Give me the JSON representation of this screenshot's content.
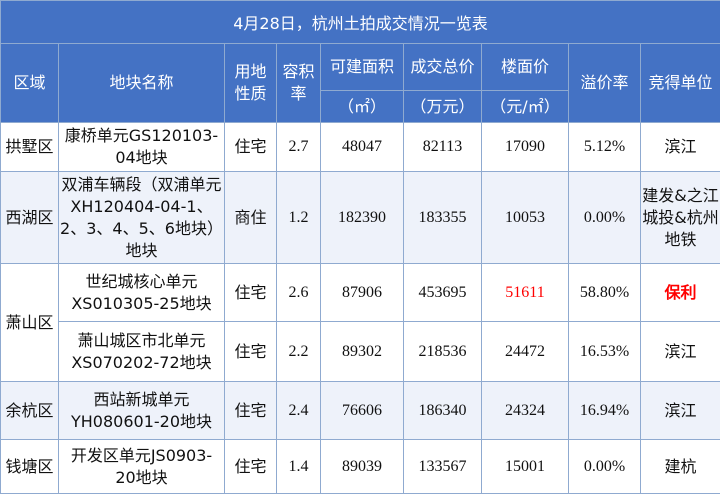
{
  "title": "4月28日，杭州土拍成交情况一览表",
  "headers": {
    "district": "区域",
    "plot_name": "地块名称",
    "land_use": "用地\n性质",
    "plot_ratio": "容积\n率",
    "buildable_area": "可建面积",
    "total_price": "成交总价",
    "floor_price": "楼面价",
    "premium_rate": "溢价率",
    "winner": "竞得单位",
    "buildable_unit": "（㎡）",
    "total_unit": "（万元）",
    "floor_unit": "（元/㎡）"
  },
  "rows": [
    {
      "district": "拱墅区",
      "plot_name": "康桥单元GS120103-04地块",
      "land_use": "住宅",
      "plot_ratio": "2.7",
      "buildable_area": "48047",
      "total_price": "82113",
      "floor_price": "17090",
      "premium_rate": "5.12%",
      "winner": "滨江"
    },
    {
      "district": "西湖区",
      "plot_name": "双浦车辆段（双浦单元XH120404-04-1、2、3、4、5、6地块）地块",
      "land_use": "商住",
      "plot_ratio": "1.2",
      "buildable_area": "182390",
      "total_price": "183355",
      "floor_price": "10053",
      "premium_rate": "0.00%",
      "winner": "建发&之江城投&杭州地铁"
    },
    {
      "district": "萧山区",
      "plot_name": "世纪城核心单元XS010305-25地块",
      "land_use": "住宅",
      "plot_ratio": "2.6",
      "buildable_area": "87906",
      "total_price": "453695",
      "floor_price": "51611",
      "premium_rate": "58.80%",
      "winner": "保利"
    },
    {
      "district": "萧山区",
      "plot_name": "萧山城区市北单元XS070202-72地块",
      "land_use": "住宅",
      "plot_ratio": "2.2",
      "buildable_area": "89302",
      "total_price": "218536",
      "floor_price": "24472",
      "premium_rate": "16.53%",
      "winner": "滨江"
    },
    {
      "district": "余杭区",
      "plot_name": "西站新城单元YH080601-20地块",
      "land_use": "住宅",
      "plot_ratio": "2.4",
      "buildable_area": "76606",
      "total_price": "186340",
      "floor_price": "24324",
      "premium_rate": "16.94%",
      "winner": "滨江"
    },
    {
      "district": "钱塘区",
      "plot_name": "开发区单元JS0903- 20地块",
      "land_use": "住宅",
      "plot_ratio": "1.4",
      "buildable_area": "89039",
      "total_price": "133567",
      "floor_price": "15001",
      "premium_rate": "0.00%",
      "winner": "建杭"
    }
  ],
  "colors": {
    "header_bg": "#4472c4",
    "highlight": "#ff0000",
    "border": "#8faad0"
  }
}
